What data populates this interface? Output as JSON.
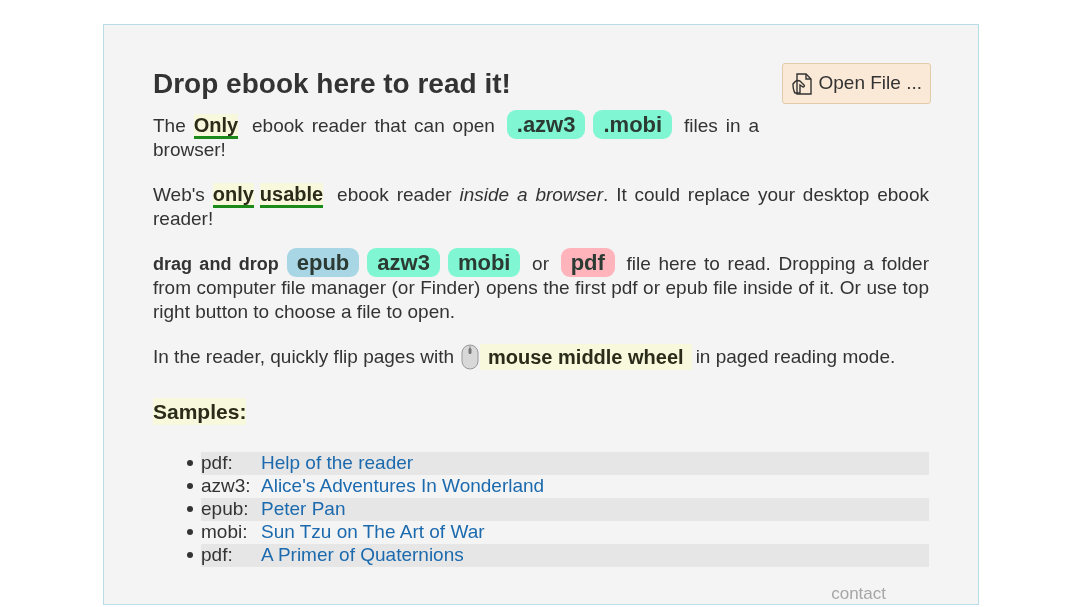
{
  "heading": "Drop ebook here to read it!",
  "open_button": {
    "label": "Open File ..."
  },
  "paragraphs": [
    {
      "segments": [
        {
          "kind": "text",
          "text": "The "
        },
        {
          "kind": "highlight",
          "text": "Only"
        },
        {
          "kind": "text",
          "text": " ebook reader that can open "
        },
        {
          "kind": "tag",
          "text": ".azw3",
          "color": "#80f7d2"
        },
        {
          "kind": "tag",
          "text": ".mobi",
          "color": "#80f7d2"
        },
        {
          "kind": "text",
          "text": " files in a browser!"
        }
      ]
    },
    {
      "segments": [
        {
          "kind": "text",
          "text": "Web's "
        },
        {
          "kind": "highlight",
          "text": "only"
        },
        {
          "kind": "highlight",
          "text": "usable"
        },
        {
          "kind": "text",
          "text": " ebook reader "
        },
        {
          "kind": "em",
          "text": "inside a browser"
        },
        {
          "kind": "text",
          "text": ". It could replace your desktop ebook reader!"
        }
      ]
    },
    {
      "segments": [
        {
          "kind": "bold",
          "text": "drag and drop"
        },
        {
          "kind": "tag",
          "text": "epub",
          "color": "#a9d6e5"
        },
        {
          "kind": "tag",
          "text": "azw3",
          "color": "#80f7d2"
        },
        {
          "kind": "tag",
          "text": "mobi",
          "color": "#80f7d2"
        },
        {
          "kind": "text",
          "text": " or "
        },
        {
          "kind": "tag",
          "text": "pdf",
          "color": "#ffb3bb"
        },
        {
          "kind": "text",
          "text": " file here to read. Dropping a folder from computer file manager (or Finder) opens the first pdf or epub file inside of it. Or use top right button to choose a file to open."
        }
      ]
    }
  ],
  "mouse_tip": {
    "before": "In the reader, quickly flip pages with",
    "highlight": "mouse middle wheel",
    "after": "in paged reading mode."
  },
  "samples_title": "Samples:",
  "samples": [
    {
      "format": "pdf:",
      "title": "Help of the reader"
    },
    {
      "format": "azw3:",
      "title": "Alice's Adventures In Wonderland"
    },
    {
      "format": "epub:",
      "title": "Peter Pan"
    },
    {
      "format": "mobi:",
      "title": "Sun Tzu on The Art of War"
    },
    {
      "format": "pdf:",
      "title": "A Primer of Quaternions"
    }
  ],
  "footer_link": "contact"
}
